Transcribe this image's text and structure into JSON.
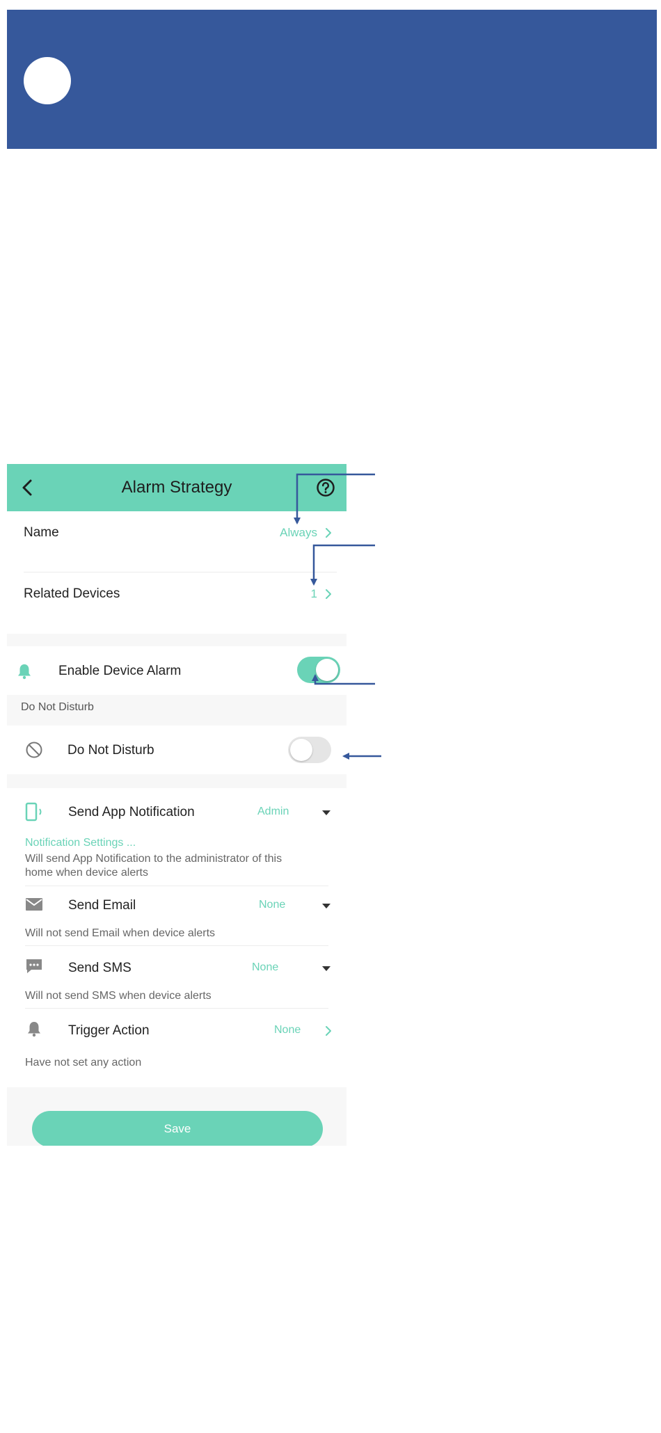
{
  "header": {
    "title": "Alarm Strategy",
    "back_icon": "chevron-left-icon",
    "help_icon": "question-circle-icon"
  },
  "name_row": {
    "label": "Name",
    "value": "Always"
  },
  "related_row": {
    "label": "Related Devices",
    "value": "1"
  },
  "enable_alarm": {
    "label": "Enable Device Alarm",
    "enabled": true,
    "icon": "bell-icon"
  },
  "dnd_section": {
    "header": "Do Not Disturb"
  },
  "dnd_row": {
    "label": "Do Not Disturb",
    "enabled": false,
    "icon": "no-sign-icon"
  },
  "notifications": {
    "app": {
      "label": "Send App Notification",
      "value": "Admin",
      "link": "Notification Settings ...",
      "desc_line1": "Will send App Notification to the administrator of this",
      "desc_line2": "home when device alerts",
      "icon": "phone-vibrate-icon"
    },
    "email": {
      "label": "Send Email",
      "value": "None",
      "desc": "Will not send Email when device alerts",
      "icon": "envelope-icon"
    },
    "sms": {
      "label": "Send SMS",
      "value": "None",
      "desc": "Will not send SMS when device alerts",
      "icon": "message-bubble-icon"
    },
    "trigger": {
      "label": "Trigger Action",
      "value": "None",
      "desc": "Have not set any action",
      "icon": "bell-icon"
    }
  },
  "save_label": "Save",
  "colors": {
    "banner": "#36589b",
    "accent": "#6ad3b7",
    "annotation": "#36589b"
  }
}
